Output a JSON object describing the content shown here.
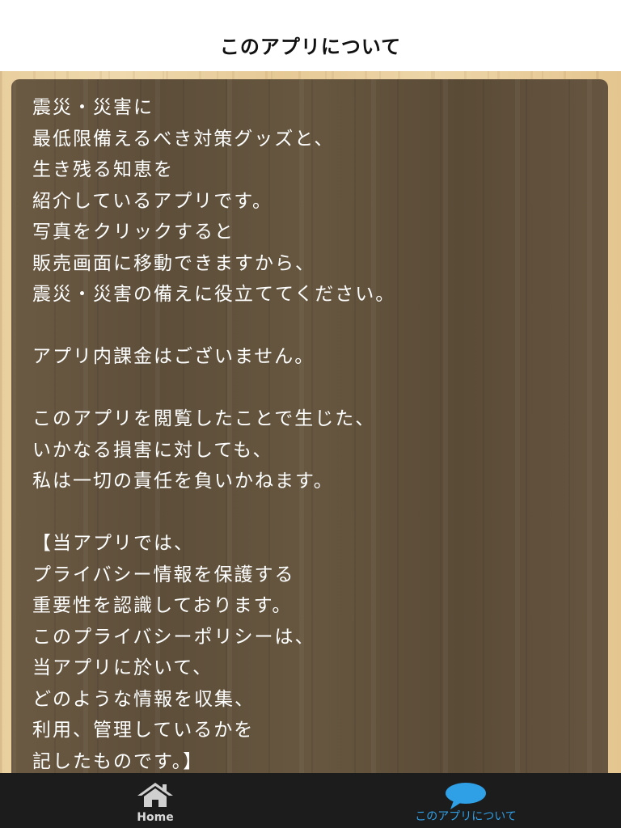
{
  "header": {
    "title": "このアプリについて"
  },
  "content": {
    "text": "震災・災害に\n最低限備えるべき対策グッズと、\n生き残る知恵を\n紹介しているアプリです。\n写真をクリックすると\n販売画面に移動できますから、\n震災・災害の備えに役立ててください。\n\nアプリ内課金はございません。\n\nこのアプリを閲覧したことで生じた、\nいかなる損害に対しても、\n私は一切の責任を負いかねます。\n\n【当アプリでは、\nプライバシー情報を保護する\n重要性を認識しております。\nこのプライバシーポリシーは、\n当アプリに於いて、\nどのような情報を収集、\n利用、管理しているかを\n記したものです。】\n当アプリでは、氏名・住所・"
  },
  "tabbar": {
    "tabs": [
      {
        "label": "Home",
        "icon": "home-icon"
      },
      {
        "label": "このアプリについて",
        "icon": "speech-bubble-icon",
        "active": true
      }
    ],
    "active_color": "#2f9fe6"
  }
}
